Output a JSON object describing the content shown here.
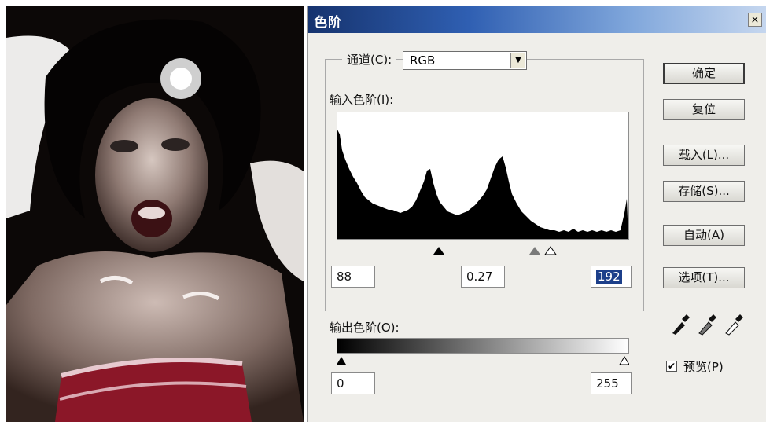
{
  "dialog": {
    "title": "色阶",
    "close_label": "×",
    "channel": {
      "label": "通道(C):",
      "value": "RGB"
    },
    "input_levels": {
      "label": "输入色阶(I):",
      "black": "88",
      "gamma": "0.27",
      "white": "192"
    },
    "output_levels": {
      "label": "输出色阶(O):",
      "black": "0",
      "white": "255"
    },
    "buttons": {
      "ok": "确定",
      "reset": "复位",
      "load": "载入(L)...",
      "save": "存储(S)...",
      "auto": "自动(A)",
      "options": "选项(T)..."
    },
    "preview": {
      "label": "预览(P)",
      "checked": true
    },
    "icons": [
      "eyedropper-black-icon",
      "eyedropper-gray-icon",
      "eyedropper-white-icon"
    ]
  },
  "colors": {
    "titlebar_start": "#16336e",
    "titlebar_end": "#c6d7ef",
    "dialog_bg": "#efeeea",
    "selection": "#1c3f8a"
  }
}
